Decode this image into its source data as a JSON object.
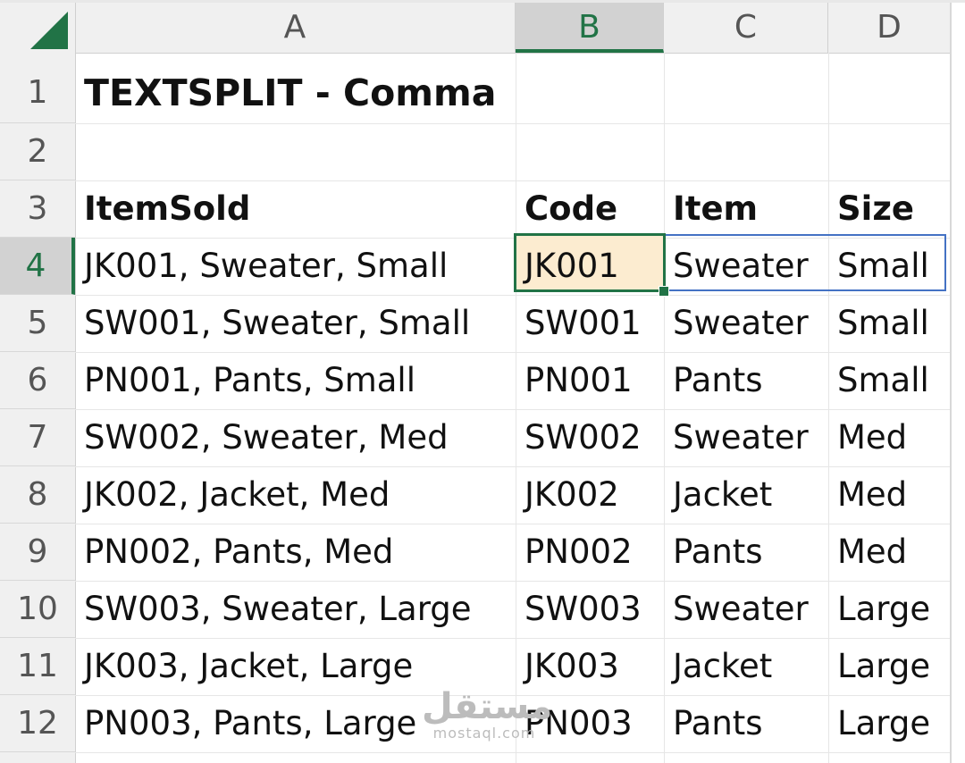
{
  "columns": [
    "A",
    "B",
    "C",
    "D"
  ],
  "rows": [
    "1",
    "2",
    "3",
    "4",
    "5",
    "6",
    "7",
    "8",
    "9",
    "10",
    "11",
    "12"
  ],
  "title": "TEXTSPLIT - Comma",
  "headers": {
    "item_sold": "ItemSold",
    "code": "Code",
    "item": "Item",
    "size": "Size"
  },
  "data": [
    {
      "item_sold": "JK001, Sweater, Small",
      "code": "JK001",
      "item": "Sweater",
      "size": "Small"
    },
    {
      "item_sold": "SW001, Sweater, Small",
      "code": "SW001",
      "item": "Sweater",
      "size": "Small"
    },
    {
      "item_sold": "PN001, Pants, Small",
      "code": "PN001",
      "item": "Pants",
      "size": "Small"
    },
    {
      "item_sold": "SW002, Sweater, Med",
      "code": "SW002",
      "item": "Sweater",
      "size": "Med"
    },
    {
      "item_sold": "JK002, Jacket, Med",
      "code": "JK002",
      "item": "Jacket",
      "size": "Med"
    },
    {
      "item_sold": "PN002, Pants, Med",
      "code": "PN002",
      "item": "Pants",
      "size": "Med"
    },
    {
      "item_sold": "SW003, Sweater, Large",
      "code": "SW003",
      "item": "Sweater",
      "size": "Large"
    },
    {
      "item_sold": "JK003, Jacket, Large",
      "code": "JK003",
      "item": "Jacket",
      "size": "Large"
    },
    {
      "item_sold": "PN003, Pants, Large",
      "code": "PN003",
      "item": "Pants",
      "size": "Large"
    }
  ],
  "selection": {
    "column": "B",
    "row": "4"
  },
  "watermark": {
    "arabic": "مستقل",
    "latin": "mostaql.com"
  },
  "colors": {
    "accent": "#217346",
    "active_cell_fill": "#fcecd0",
    "spill_border": "#4472c4"
  }
}
